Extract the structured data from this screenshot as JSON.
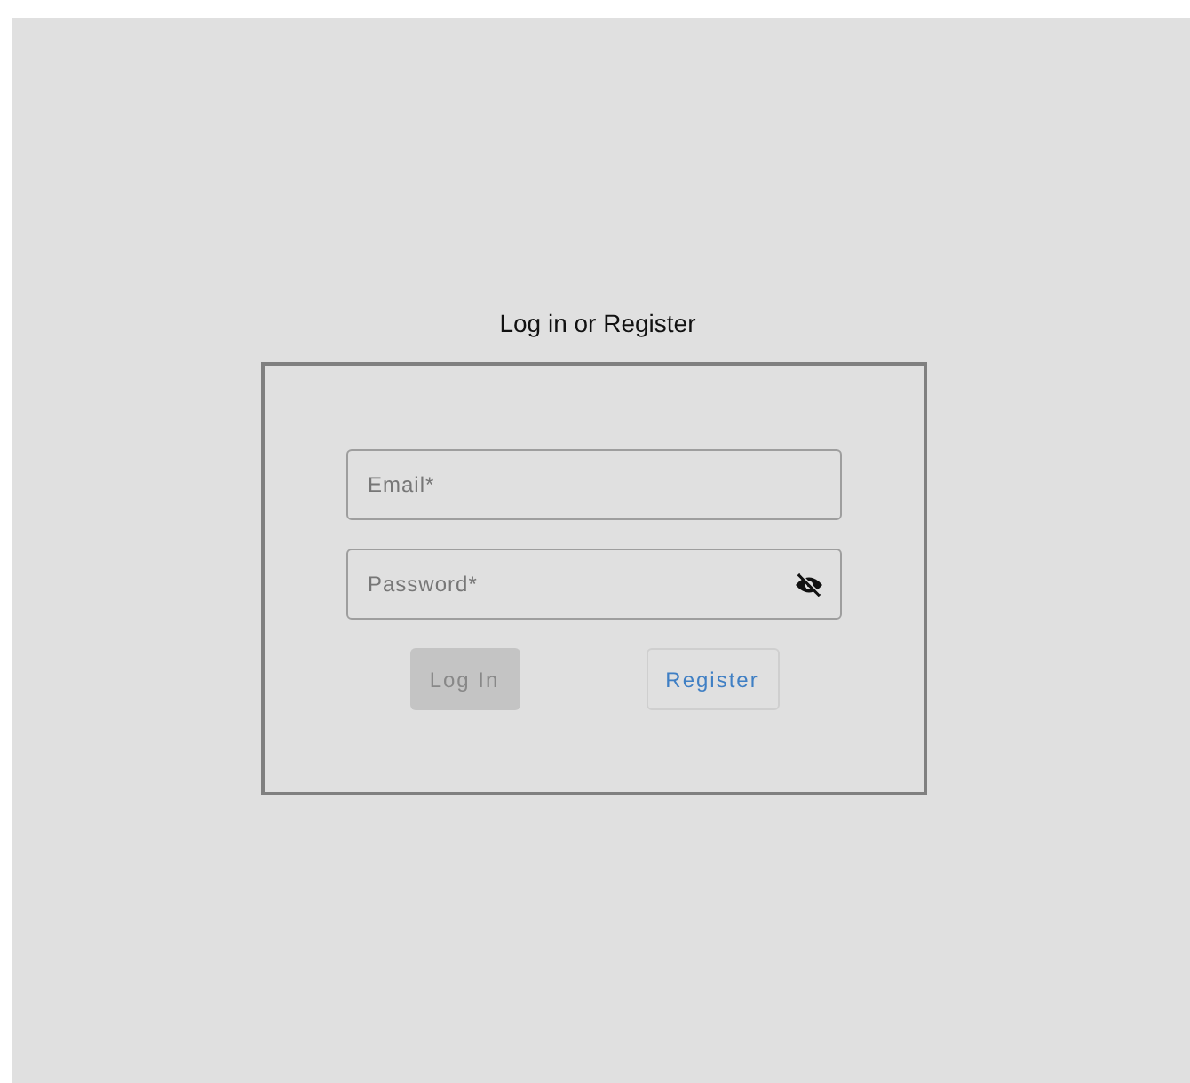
{
  "title": "Log in or Register",
  "fields": [
    {
      "placeholder": "Email*",
      "kind": "text"
    },
    {
      "placeholder": "Password*",
      "kind": "password",
      "visible": false
    }
  ],
  "buttons": [
    {
      "label": "Log In",
      "kind": "filled",
      "disabled": true
    },
    {
      "label": "Register",
      "kind": "outlined",
      "disabled": false
    }
  ]
}
